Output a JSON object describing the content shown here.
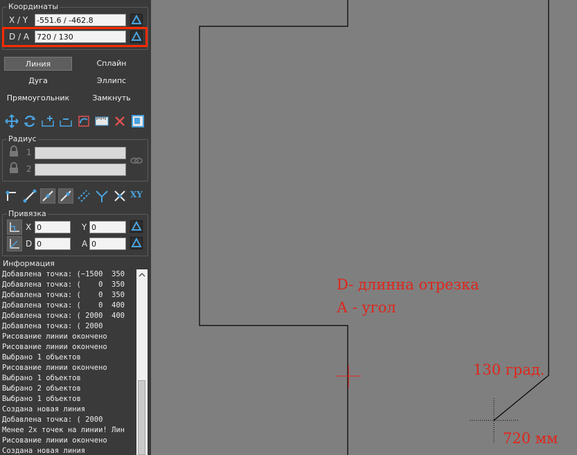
{
  "panel": {
    "coords": {
      "title": "Координаты",
      "xy_label": "X / Y",
      "xy_value": "-551.6 / -462.8",
      "da_label": "D / A",
      "da_value": "720 / 130"
    },
    "tools": {
      "line": "Линия",
      "spline": "Сплайн",
      "arc": "Дуга",
      "ellipse": "Эллипс",
      "rectangle": "Прямоугольник",
      "close": "Замкнуть"
    },
    "radius": {
      "title": "Радиус",
      "r1_label": "1",
      "r2_label": "2",
      "r1_value": "",
      "r2_value": ""
    },
    "snap": {
      "title": "Привязка",
      "x_label": "X",
      "x_value": "0",
      "y_label": "Y",
      "y_value": "0",
      "d_label": "D",
      "d_value": "0",
      "a_label": "A",
      "a_value": "0",
      "xy_icon_text": "XY"
    },
    "info": {
      "title": "Информация",
      "lines": [
        "Добавлена точка: (−1500  350",
        "Добавлена точка: (    0  350",
        "Добавлена точка: (    0  350",
        "Добавлена точка: (    0  400",
        "Добавлена точка: ( 2000  400",
        "Добавлена точка: ( 2000",
        "Рисование линии окончено",
        "Рисование линии окончено",
        "Выбрано 1 объектов",
        "Рисование линии окончено",
        "Выбрано 1 объектов",
        "Выбрано 2 объектов",
        "Выбрано 1 объектов",
        "Создана новая линия",
        "Добавлена точка: ( 2000    ",
        "Менее 2х точек на линии! Лин",
        "Рисование линии окончено",
        "Создана новая линия"
      ]
    }
  },
  "canvas": {
    "annotation_d": "D- длинна отрезка",
    "annotation_a": "А - угол",
    "annotation_angle": "130 град.",
    "annotation_length": "720 мм"
  },
  "colors": {
    "highlight": "#ff2a00",
    "annotation": "#e0251b",
    "icon_blue": "#4aa3e0",
    "canvas_bg": "#7f7f7f",
    "panel_bg": "#3a3a3a"
  }
}
